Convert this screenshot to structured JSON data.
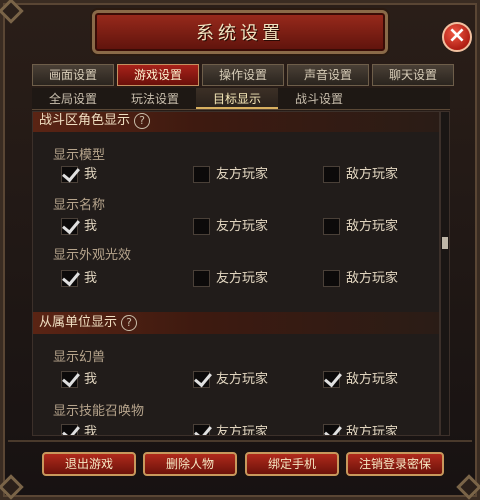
{
  "window": {
    "title": "系统设置",
    "close_label": "×"
  },
  "tabs": [
    {
      "label": "画面设置",
      "active": false
    },
    {
      "label": "游戏设置",
      "active": true
    },
    {
      "label": "操作设置",
      "active": false
    },
    {
      "label": "声音设置",
      "active": false
    },
    {
      "label": "聊天设置",
      "active": false
    }
  ],
  "subtabs": [
    {
      "label": "全局设置",
      "active": false
    },
    {
      "label": "玩法设置",
      "active": false
    },
    {
      "label": "目标显示",
      "active": true
    },
    {
      "label": "战斗设置",
      "active": false
    }
  ],
  "sections": [
    {
      "title": "战斗区角色显示",
      "help": "?"
    },
    {
      "title": "从属单位显示",
      "help": "?"
    }
  ],
  "groups": [
    {
      "label": "显示模型",
      "options": [
        {
          "label": "我",
          "checked": true
        },
        {
          "label": "友方玩家",
          "checked": false
        },
        {
          "label": "敌方玩家",
          "checked": false
        }
      ]
    },
    {
      "label": "显示名称",
      "options": [
        {
          "label": "我",
          "checked": true
        },
        {
          "label": "友方玩家",
          "checked": false
        },
        {
          "label": "敌方玩家",
          "checked": false
        }
      ]
    },
    {
      "label": "显示外观光效",
      "options": [
        {
          "label": "我",
          "checked": true
        },
        {
          "label": "友方玩家",
          "checked": false
        },
        {
          "label": "敌方玩家",
          "checked": false
        }
      ]
    },
    {
      "label": "显示幻兽",
      "options": [
        {
          "label": "我",
          "checked": true
        },
        {
          "label": "友方玩家",
          "checked": true
        },
        {
          "label": "敌方玩家",
          "checked": true
        }
      ]
    },
    {
      "label": "显示技能召唤物",
      "options": [
        {
          "label": "我",
          "checked": true
        },
        {
          "label": "友方玩家",
          "checked": true
        },
        {
          "label": "敌方玩家",
          "checked": true
        }
      ]
    }
  ],
  "buttons": {
    "exit": "退出游戏",
    "delete": "删除人物",
    "bind": "绑定手机",
    "cancel_pwd": "注销登录密保"
  }
}
